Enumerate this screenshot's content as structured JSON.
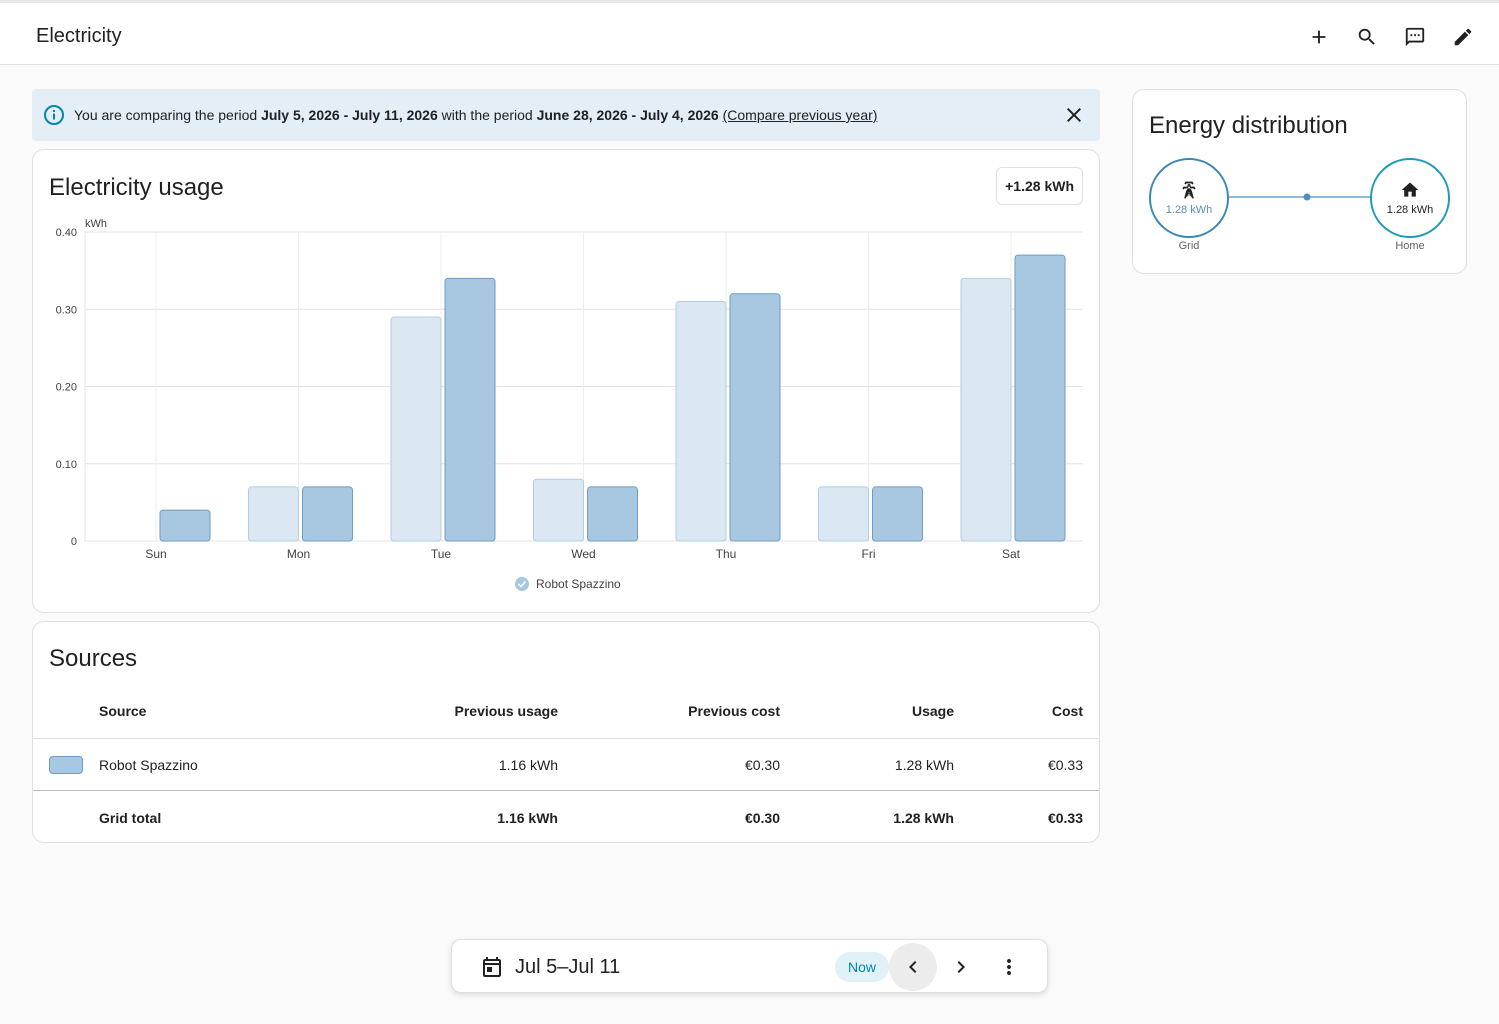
{
  "header": {
    "title": "Electricity"
  },
  "alert": {
    "prefix": "You are comparing the period ",
    "period": "July 5, 2026 - July 11, 2026",
    "middle": " with the period ",
    "compare_period": "June 28, 2026 - July 4, 2026",
    "link": "(Compare previous year)"
  },
  "usage_card": {
    "title": "Electricity usage",
    "delta": "+1.28 kWh"
  },
  "chart_data": {
    "type": "bar",
    "categories": [
      "Sun",
      "Mon",
      "Tue",
      "Wed",
      "Thu",
      "Fri",
      "Sat"
    ],
    "ylabel": "kWh",
    "ylim": [
      0,
      0.4
    ],
    "yticks": [
      "0",
      "0.10",
      "0.20",
      "0.30",
      "0.40"
    ],
    "grid": true,
    "legend": "bottom",
    "series": [
      {
        "name": "Robot Spazzino",
        "role": "previous",
        "color": "#dbe8f3",
        "values": [
          0,
          0.07,
          0.29,
          0.08,
          0.31,
          0.07,
          0.34
        ]
      },
      {
        "name": "Robot Spazzino",
        "role": "current",
        "color": "#a8c8e2",
        "values": [
          0.04,
          0.07,
          0.34,
          0.07,
          0.32,
          0.07,
          0.37
        ]
      }
    ]
  },
  "sources": {
    "title": "Sources",
    "columns": [
      "Source",
      "Previous usage",
      "Previous cost",
      "Usage",
      "Cost"
    ],
    "rows": [
      {
        "source": "Robot Spazzino",
        "prev_usage": "1.16 kWh",
        "prev_cost": "€0.30",
        "usage": "1.28 kWh",
        "cost": "€0.33"
      }
    ],
    "total": {
      "label": "Grid total",
      "prev_usage": "1.16 kWh",
      "prev_cost": "€0.30",
      "usage": "1.28 kWh",
      "cost": "€0.33"
    }
  },
  "distribution": {
    "title": "Energy distribution",
    "grid": {
      "value": "1.28 kWh",
      "label": "Grid"
    },
    "home": {
      "value": "1.28 kWh",
      "label": "Home"
    }
  },
  "datebar": {
    "range": "Jul 5–Jul 11",
    "now": "Now"
  },
  "colors": {
    "accent": "#0288a8",
    "bar_current": "#a8c8e2",
    "bar_previous": "#dbe8f3"
  }
}
